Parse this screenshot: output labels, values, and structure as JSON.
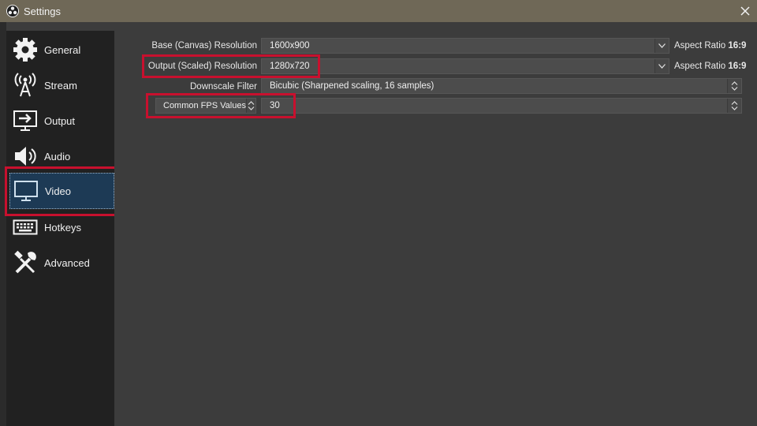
{
  "window": {
    "title": "Settings",
    "close_icon": "close-icon",
    "app_icon": "obs-logo-icon"
  },
  "sidebar": {
    "items": [
      {
        "label": "General",
        "icon": "gear-icon",
        "selected": false
      },
      {
        "label": "Stream",
        "icon": "broadcast-antenna-icon",
        "selected": false
      },
      {
        "label": "Output",
        "icon": "output-monitor-icon",
        "selected": false
      },
      {
        "label": "Audio",
        "icon": "speaker-icon",
        "selected": false
      },
      {
        "label": "Video",
        "icon": "monitor-icon",
        "selected": true
      },
      {
        "label": "Hotkeys",
        "icon": "keyboard-icon",
        "selected": false
      },
      {
        "label": "Advanced",
        "icon": "tools-icon",
        "selected": false
      }
    ]
  },
  "video": {
    "base_resolution": {
      "label": "Base (Canvas) Resolution",
      "value": "1600x900",
      "aspect_label": "Aspect Ratio",
      "aspect_value": "16:9"
    },
    "output_resolution": {
      "label": "Output (Scaled) Resolution",
      "value": "1280x720",
      "aspect_label": "Aspect Ratio",
      "aspect_value": "16:9"
    },
    "downscale_filter": {
      "label": "Downscale Filter",
      "value": "Bicubic (Sharpened scaling, 16 samples)"
    },
    "fps": {
      "type_label": "Common FPS Values",
      "value": "30"
    }
  },
  "colors": {
    "titlebar": "#6f6857",
    "sidebar": "#212121",
    "content": "#3c3c3c",
    "selected": "#1d3a55",
    "highlight": "#c8102e"
  }
}
